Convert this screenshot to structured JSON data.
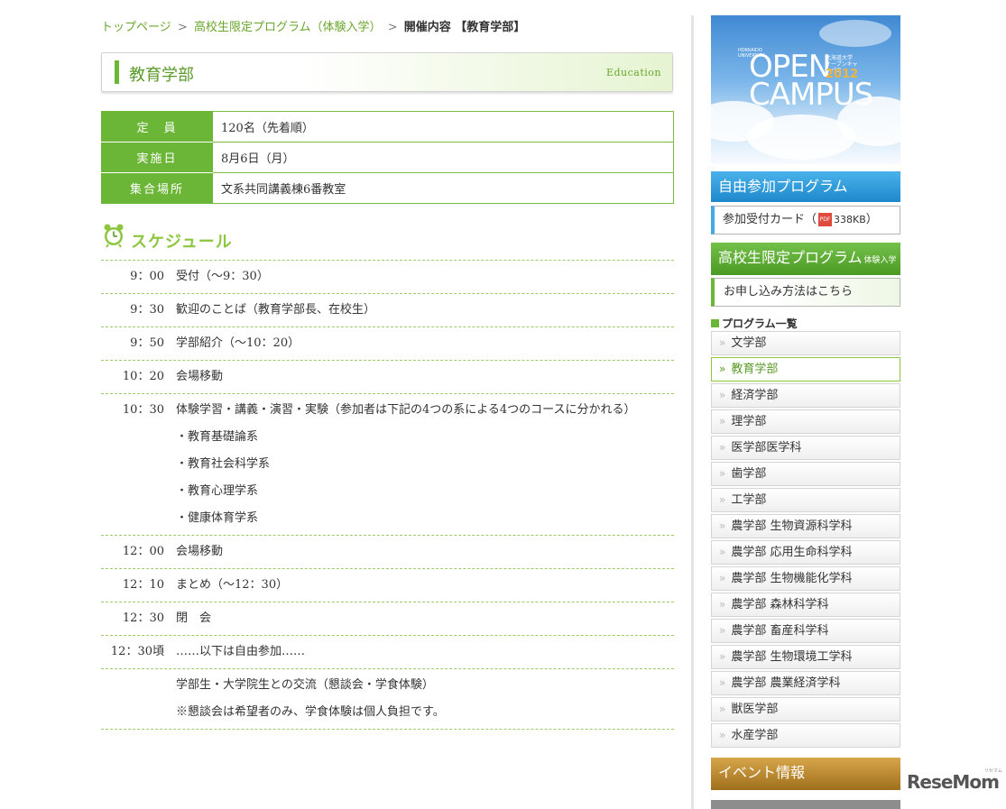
{
  "breadcrumb": {
    "home": "トップページ",
    "program": "高校生限定プログラム（体験入学）",
    "current": "開催内容 【教育学部】",
    "separator": ">"
  },
  "page": {
    "title": "教育学部",
    "title_en": "Education"
  },
  "info": [
    {
      "label": "定　員",
      "value": "120名（先着順）"
    },
    {
      "label": "実施日",
      "value": "8月6日（月）"
    },
    {
      "label": "集合場所",
      "value": "文系共同講義棟6番教室"
    }
  ],
  "schedule": {
    "title": "スケジュール",
    "rows": [
      {
        "time": "9：00",
        "desc": "受付（〜9：30）"
      },
      {
        "time": "9：30",
        "desc": "歓迎のことば（教育学部長、在校生）"
      },
      {
        "time": "9：50",
        "desc": "学部紹介（〜10：20）"
      },
      {
        "time": "10：20",
        "desc": "会場移動"
      },
      {
        "time": "10：30",
        "desc": "体験学習・講義・演習・実験（参加者は下記の4つの系による4つのコースに分かれる）",
        "subs": [
          "・教育基礎論系",
          "・教育社会科学系",
          "・教育心理学系",
          "・健康体育学系"
        ]
      },
      {
        "time": "12：00",
        "desc": "会場移動"
      },
      {
        "time": "12：10",
        "desc": "まとめ（〜12：30）"
      },
      {
        "time": "12：30",
        "desc": "閉　会"
      },
      {
        "time": "12：30頃",
        "desc": "……以下は自由参加……"
      },
      {
        "time": "",
        "desc": "学部生・大学院生との交流（懇談会・学食体験）",
        "subs": [
          "※懇談会は希望者のみ、学食体験は個人負担です。"
        ]
      }
    ]
  },
  "sidebar": {
    "banner": {
      "open": "OPEN",
      "campus": "CAMPUS",
      "year": "2012",
      "univ_ja": "北海道大学 オープンキャンパス",
      "univ_en": "HOKKAIDO UNIVERSITY"
    },
    "free_program": "自由参加プログラム",
    "card_label": "参加受付カード（",
    "card_pdf": "PDF",
    "card_size": "338KB",
    "card_close": "）",
    "hs_program": "高校生限定プログラム",
    "hs_program_small": "体験入学",
    "apply_link": "お申し込み方法はこちら",
    "list_title": "プログラム一覧",
    "programs": [
      "文学部",
      "教育学部",
      "経済学部",
      "理学部",
      "医学部医学科",
      "歯学部",
      "工学部",
      "農学部 生物資源科学科",
      "農学部 応用生命科学科",
      "農学部 生物機能化学科",
      "農学部 森林科学科",
      "農学部 畜産科学科",
      "農学部 生物環境工学科",
      "農学部 農業経済学科",
      "獣医学部",
      "水産学部"
    ],
    "active_index": 1,
    "event": "イベント情報"
  },
  "watermark": {
    "brand": "ReseMom",
    "kana": "リセマム"
  },
  "colors": {
    "green": "#6bb537",
    "blue": "#1e88cc",
    "gold": "#a06f1c"
  }
}
